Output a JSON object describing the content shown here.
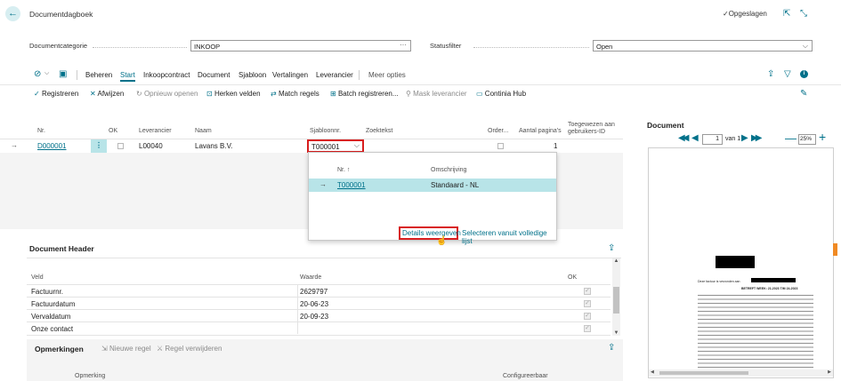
{
  "header": {
    "title": "Documentdagboek",
    "saved_label": "Opgeslagen"
  },
  "filters": {
    "category_label": "Documentcategorie",
    "category_value": "INKOOP",
    "status_label": "Statusfilter",
    "status_value": "Open"
  },
  "tabs": {
    "items": [
      "Beheren",
      "Start",
      "Inkoopcontract",
      "Document",
      "Sjabloon",
      "Vertalingen",
      "Leverancier"
    ],
    "more": "Meer opties",
    "active": "Start"
  },
  "actions": {
    "items": [
      "Registreren",
      "Afwijzen",
      "Opnieuw openen",
      "Herken velden",
      "Match regels",
      "Batch registreren...",
      "Mask leverancier",
      "Continia Hub"
    ]
  },
  "grid": {
    "columns": {
      "nr": "Nr.",
      "ok": "OK",
      "vendor": "Leverancier",
      "name": "Naam",
      "template": "Sjabloonnr.",
      "search": "Zoektekst",
      "order": "Order...",
      "pages": "Aantal pagina's",
      "assigned": "Toegewezen aan gebruikers-ID"
    },
    "row": {
      "nr": "D000001",
      "vendor": "L00040",
      "name": "Lavans B.V.",
      "template": "T000001",
      "pages": "1"
    }
  },
  "dropdown": {
    "col_nr": "Nr. ↑",
    "col_desc": "Omschrijving",
    "row_nr": "T000001",
    "row_desc": "Standaard - NL",
    "details_link": "Details weergeven",
    "select_full_link": "Selecteren vanuit volledige lijst"
  },
  "doc_header": {
    "title": "Document Header",
    "col_field": "Veld",
    "col_value": "Waarde",
    "col_ok": "OK",
    "rows": [
      {
        "field": "Factuurnr.",
        "value": "2629797"
      },
      {
        "field": "Factuurdatum",
        "value": "20-06-23"
      },
      {
        "field": "Vervaldatum",
        "value": "20-09-23"
      },
      {
        "field": "Onze contact",
        "value": ""
      }
    ]
  },
  "remarks": {
    "title": "Opmerkingen",
    "new_line": "Nieuwe regel",
    "delete_line": "Regel verwijderen",
    "col_remark": "Opmerking",
    "col_configurable": "Configureerbaar"
  },
  "document_panel": {
    "title": "Document",
    "page_value": "1",
    "page_of": "van 1",
    "zoom": "25%",
    "preview_heading": "BETREFT WEEK: 21-2023 T/M 24-2023",
    "preview_intro": "Deze factuur is verzonden aan"
  },
  "colors": {
    "accent": "#00718a",
    "selected_row": "#b8e4e8",
    "highlight": "#d81e1e"
  }
}
